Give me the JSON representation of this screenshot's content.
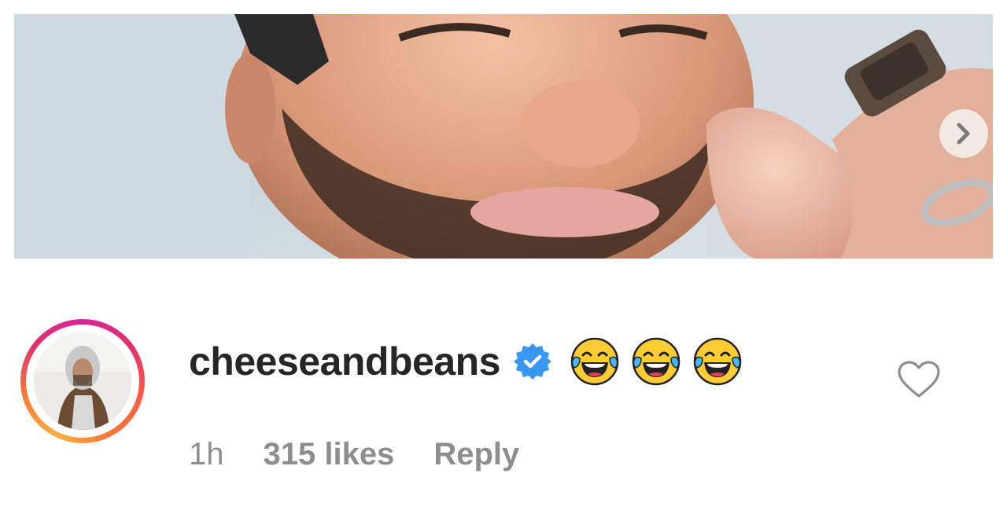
{
  "post": {
    "image_alt": "",
    "carousel_next_icon": "chevron-right-icon"
  },
  "comment": {
    "username": "cheeseandbeans",
    "verified_icon": "verified-badge-icon",
    "emojis": [
      "face-with-tears-of-joy",
      "face-with-tears-of-joy",
      "face-with-tears-of-joy"
    ],
    "timestamp": "1h",
    "likes": "315 likes",
    "reply_label": "Reply",
    "like_icon": "heart-icon"
  },
  "colors": {
    "username": "#262626",
    "meta_text": "#8e8e8e",
    "verified_blue": "#3897f0",
    "story_ring_start": "#d6249f",
    "story_ring_end": "#fcaf45"
  }
}
